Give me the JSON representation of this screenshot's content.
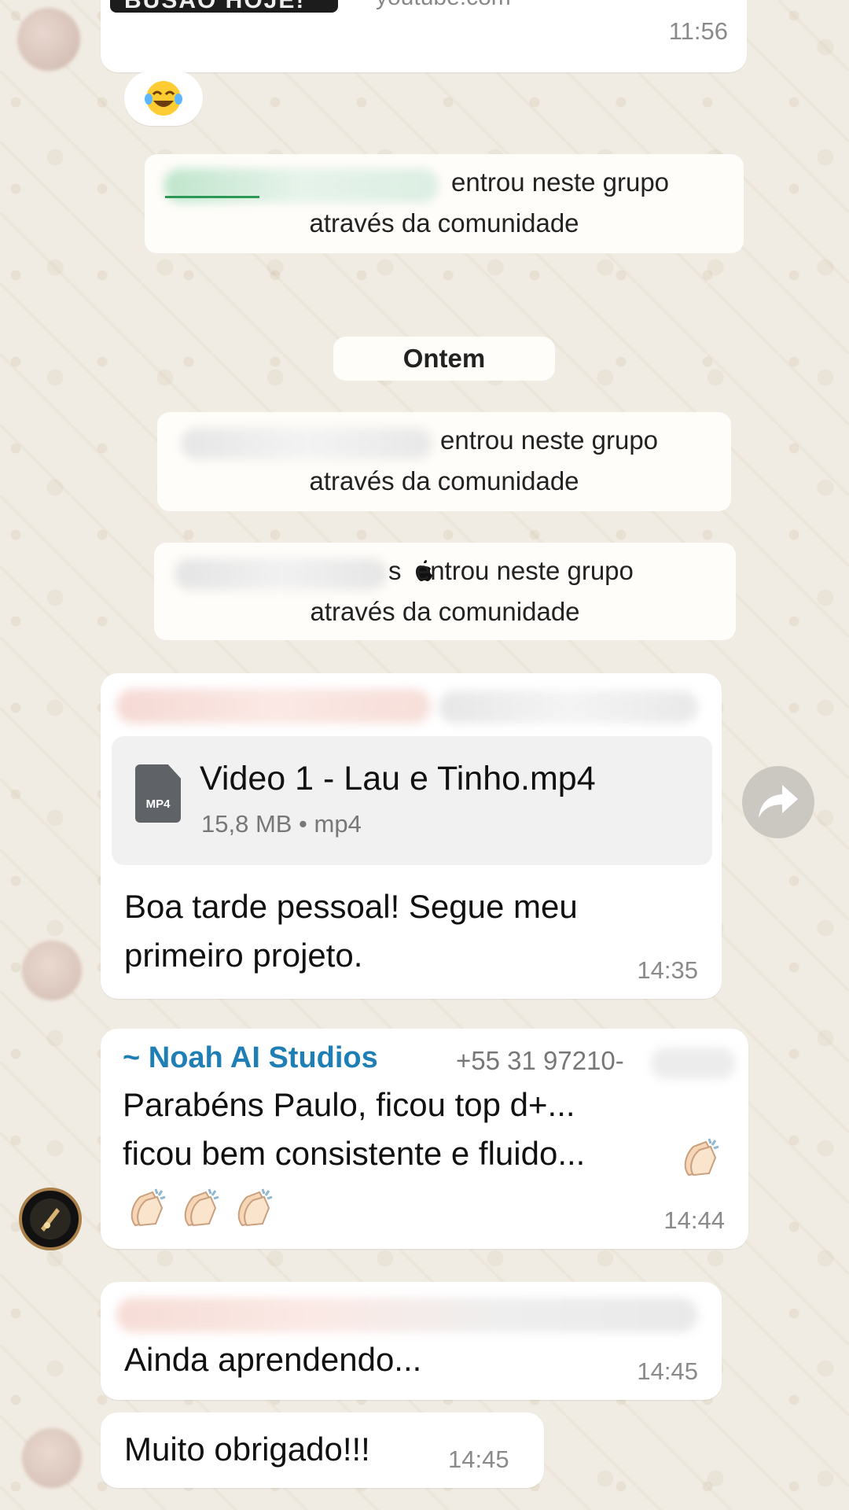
{
  "messages": {
    "top_link": {
      "banner_text": "BUSAO HOJE!",
      "domain": "youtube.com",
      "time": "11:56"
    },
    "system_joins": [
      {
        "suffix": "entrou neste grupo",
        "line2": "através da comunidade"
      },
      {
        "suffix": "entrou neste grupo",
        "line2": "através da comunidade"
      },
      {
        "suffix": "s  entrou neste grupo",
        "line2": "através da comunidade"
      }
    ],
    "date_divider": "Ontem",
    "file_message": {
      "file_type_label": "MP4",
      "file_name": "Video 1 - Lau e Tinho.mp4",
      "file_meta": "15,8 MB • mp4",
      "caption_line1": "Boa tarde pessoal! Segue meu",
      "caption_line2": "primeiro projeto.",
      "time": "14:35"
    },
    "noah_message": {
      "sender_name": "~ Noah AI Studios",
      "sender_phone": "+55 31 97210-",
      "line1": "Parabéns Paulo, ficou top d+...",
      "line2": "ficou bem consistente e fluido...",
      "time": "14:44"
    },
    "reply_1": {
      "text": "Ainda aprendendo...",
      "time": "14:45"
    },
    "reply_2": {
      "text": "Muito obrigado!!!",
      "time": "14:45"
    }
  },
  "icons": {
    "laugh": "face-with-tears-of-joy-icon",
    "clap": "clapping-hands-icon",
    "forward": "forward-arrow-icon",
    "file": "mp4-file-icon",
    "apple": "apple-logo-icon"
  },
  "colors": {
    "background": "#f1ece3",
    "bubble": "#ffffff",
    "sender_blue": "#1f7fb5",
    "time_gray": "#8a8a8a",
    "file_card": "#f1f1f1"
  }
}
